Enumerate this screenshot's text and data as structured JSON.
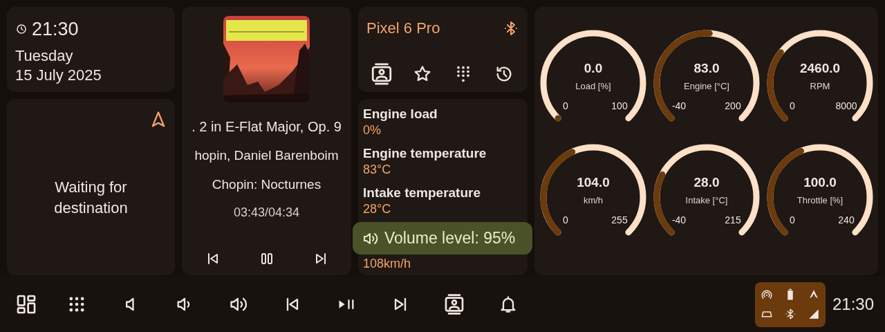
{
  "clock": {
    "time": "21:30",
    "weekday": "Tuesday",
    "date": "15 July 2025"
  },
  "navigation": {
    "message": "Waiting for destination"
  },
  "media": {
    "title": ". 2 in E-Flat Major, Op. 9",
    "artist": "hopin, Daniel Barenboim",
    "album": "Chopin: Nocturnes",
    "time": "03:43/04:34",
    "controls": [
      {
        "kind": "previous"
      },
      {
        "kind": "pause"
      },
      {
        "kind": "next"
      }
    ]
  },
  "phone": {
    "device": "Pixel 6 Pro",
    "actions": [
      {
        "kind": "contacts"
      },
      {
        "kind": "favorites"
      },
      {
        "kind": "dialpad"
      },
      {
        "kind": "history"
      }
    ]
  },
  "obd": {
    "items": [
      {
        "label": "Engine load",
        "value": "0%"
      },
      {
        "label": "Engine temperature",
        "value": "83°C"
      },
      {
        "label": "Intake temperature",
        "value": "28°C"
      },
      {
        "value": "108km/h"
      }
    ]
  },
  "gauges": [
    {
      "value": "0.0",
      "label": "Load [%]",
      "min": "0",
      "max": "100"
    },
    {
      "value": "83.0",
      "label": "Engine [°C]",
      "min": "-40",
      "max": "200"
    },
    {
      "value": "2460.0",
      "label": "RPM",
      "min": "0",
      "max": "8000"
    },
    {
      "value": "104.0",
      "label": "km/h",
      "min": "0",
      "max": "255"
    },
    {
      "value": "28.0",
      "label": "Intake [°C]",
      "min": "-40",
      "max": "215"
    },
    {
      "value": "100.0",
      "label": "Throttle [%]",
      "min": "0",
      "max": "240"
    }
  ],
  "volume_toast": {
    "text": "Volume level: 95%"
  },
  "taskbar": {
    "buttons": [
      {
        "kind": "dashboard"
      },
      {
        "kind": "apps"
      },
      {
        "kind": "volume-mute"
      },
      {
        "kind": "volume-down"
      },
      {
        "kind": "volume-up"
      },
      {
        "kind": "previous"
      },
      {
        "kind": "play-pause"
      },
      {
        "kind": "next"
      },
      {
        "kind": "contacts"
      },
      {
        "kind": "notifications"
      }
    ],
    "status_icons": [
      {
        "kind": "hotspot"
      },
      {
        "kind": "battery"
      },
      {
        "kind": "auto"
      },
      {
        "kind": "device"
      },
      {
        "kind": "bluetooth"
      },
      {
        "kind": "signal"
      }
    ],
    "time": "21:30"
  }
}
